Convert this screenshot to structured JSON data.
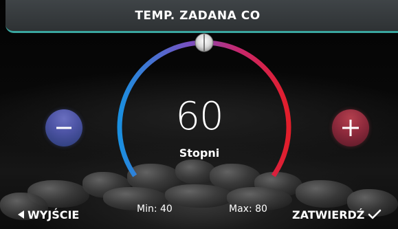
{
  "header": {
    "title": "TEMP. ZADANA CO"
  },
  "dial": {
    "value": "60",
    "unit": "Stopni",
    "min": 40,
    "max": 80,
    "level": 0.5,
    "gradient_colors": [
      "#1a8fe0",
      "#7a4fc0",
      "#c6286f",
      "#e21e2a"
    ]
  },
  "controls": {
    "minus_icon": "minus-icon",
    "plus_icon": "plus-icon"
  },
  "footer": {
    "back_label": "WYJŚCIE",
    "min_label": "Min: 40",
    "max_label": "Max: 80",
    "confirm_label": "ZATWIERDŹ"
  },
  "colors": {
    "header_bg": "#3a3f42",
    "header_accent": "#3aa7a0",
    "minus_button": "#4e55a6",
    "plus_button": "#8e2a3c"
  }
}
